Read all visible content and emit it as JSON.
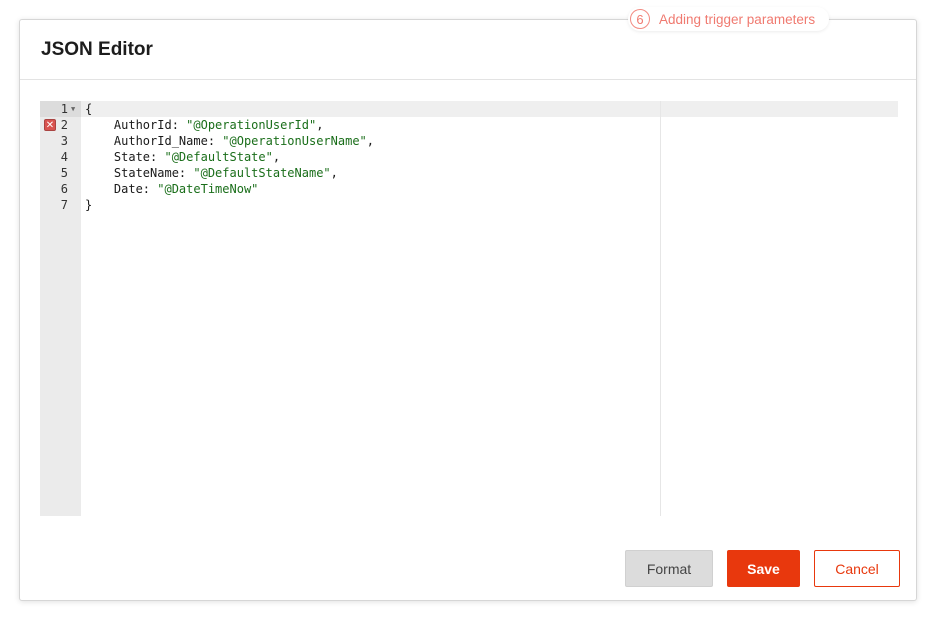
{
  "callout": {
    "step": "6",
    "text": "Adding trigger parameters"
  },
  "dialog": {
    "title": "JSON Editor"
  },
  "editor": {
    "lines": [
      {
        "num": "1",
        "parts": [
          {
            "t": "{",
            "k": "p"
          }
        ]
      },
      {
        "num": "2",
        "error": true,
        "parts": [
          {
            "t": "    AuthorId: ",
            "k": "p"
          },
          {
            "t": "\"@OperationUserId\"",
            "k": "s"
          },
          {
            "t": ",",
            "k": "p"
          }
        ]
      },
      {
        "num": "3",
        "parts": [
          {
            "t": "    AuthorId_Name: ",
            "k": "p"
          },
          {
            "t": "\"@OperationUserName\"",
            "k": "s"
          },
          {
            "t": ",",
            "k": "p"
          }
        ]
      },
      {
        "num": "4",
        "parts": [
          {
            "t": "    State: ",
            "k": "p"
          },
          {
            "t": "\"@DefaultState\"",
            "k": "s"
          },
          {
            "t": ",",
            "k": "p"
          }
        ]
      },
      {
        "num": "5",
        "parts": [
          {
            "t": "    StateName: ",
            "k": "p"
          },
          {
            "t": "\"@DefaultStateName\"",
            "k": "s"
          },
          {
            "t": ",",
            "k": "p"
          }
        ]
      },
      {
        "num": "6",
        "parts": [
          {
            "t": "    Date: ",
            "k": "p"
          },
          {
            "t": "\"@DateTimeNow\"",
            "k": "s"
          }
        ]
      },
      {
        "num": "7",
        "parts": [
          {
            "t": "}",
            "k": "p"
          }
        ]
      }
    ],
    "error_icon": "error-x-icon",
    "fold_icon": "fold-arrow-icon"
  },
  "buttons": {
    "format": "Format",
    "save": "Save",
    "cancel": "Cancel"
  },
  "colors": {
    "accent": "#e8380d",
    "callout": "#f07a70",
    "string": "#1a6e1a"
  }
}
